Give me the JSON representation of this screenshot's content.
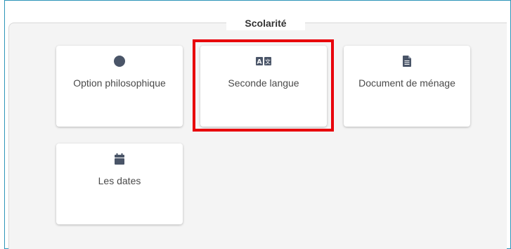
{
  "section": {
    "title": "Scolarité"
  },
  "cards": [
    {
      "label": "Option philosophique",
      "icon": "circle-icon"
    },
    {
      "label": "Seconde langue",
      "icon": "language-icon",
      "icon_text": "A 文"
    },
    {
      "label": "Document de ménage",
      "icon": "document-icon"
    },
    {
      "label": "Les dates",
      "icon": "calendar-icon"
    }
  ],
  "colors": {
    "frame_border": "#2e95b8",
    "icon": "#4a5568",
    "highlight": "#e8000b",
    "panel_bg": "#f4f4f4"
  }
}
